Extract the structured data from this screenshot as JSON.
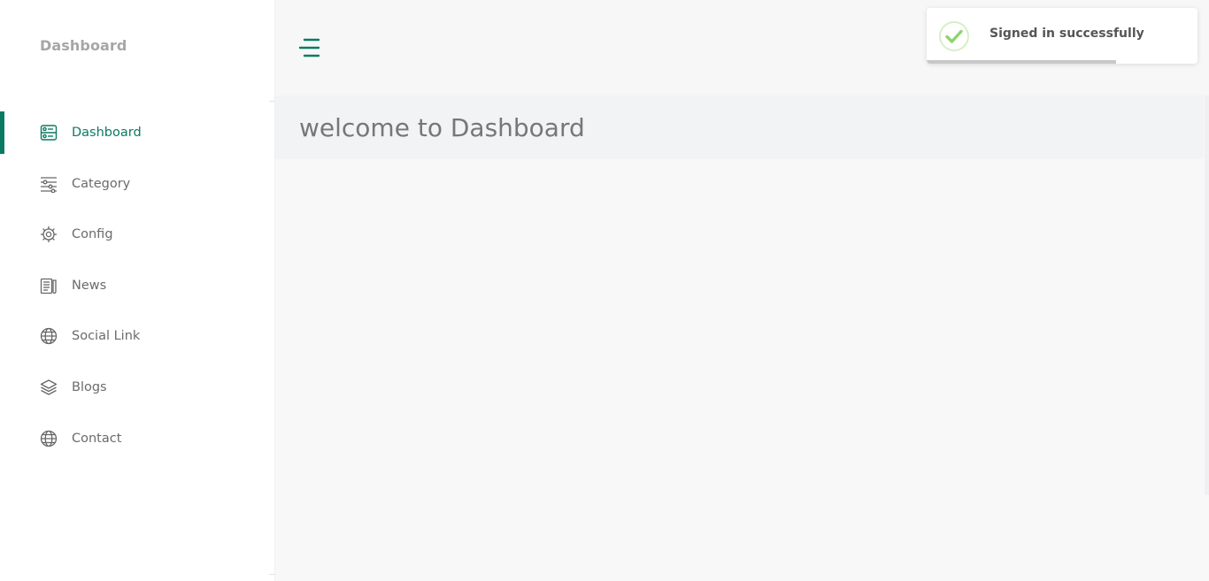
{
  "sidebar": {
    "brand": "Dashboard",
    "items": [
      {
        "label": "Dashboard",
        "icon": "dashboard-icon",
        "active": true
      },
      {
        "label": "Category",
        "icon": "sliders-icon",
        "active": false
      },
      {
        "label": "Config",
        "icon": "gear-icon",
        "active": false
      },
      {
        "label": "News",
        "icon": "news-icon",
        "active": false
      },
      {
        "label": "Social Link",
        "icon": "globe-icon",
        "active": false
      },
      {
        "label": "Blogs",
        "icon": "layers-icon",
        "active": false
      },
      {
        "label": "Contact",
        "icon": "globe-icon",
        "active": false
      }
    ]
  },
  "header": {
    "menu_icon": "hamburger-menu-icon"
  },
  "main": {
    "welcome": "welcome to Dashboard"
  },
  "toast": {
    "message": "Signed in successfully",
    "icon": "success-check-icon",
    "progress": 0.7
  },
  "colors": {
    "accent": "#0b7a63",
    "success": "#8fd36d"
  }
}
